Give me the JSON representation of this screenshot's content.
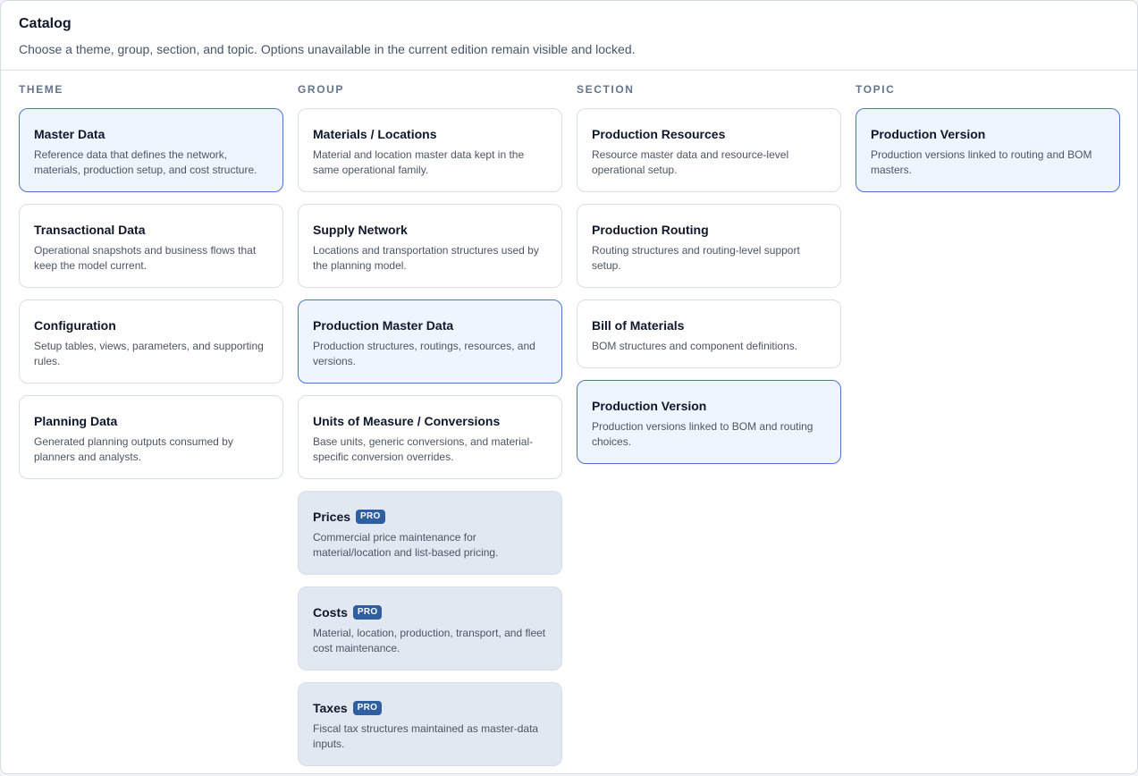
{
  "header": {
    "title": "Catalog",
    "subtitle": "Choose a theme, group, section, and topic. Options unavailable in the current edition remain visible and locked."
  },
  "columns": {
    "theme": {
      "heading": "THEME",
      "items": [
        {
          "title": "Master Data",
          "desc": "Reference data that defines the network, materials, production setup, and cost structure.",
          "state": "selected"
        },
        {
          "title": "Transactional Data",
          "desc": "Operational snapshots and business flows that keep the model current.",
          "state": "normal"
        },
        {
          "title": "Configuration",
          "desc": "Setup tables, views, parameters, and supporting rules.",
          "state": "normal"
        },
        {
          "title": "Planning Data",
          "desc": "Generated planning outputs consumed by planners and analysts.",
          "state": "normal"
        }
      ]
    },
    "group": {
      "heading": "GROUP",
      "items": [
        {
          "title": "Materials / Locations",
          "desc": "Material and location master data kept in the same operational family.",
          "state": "normal"
        },
        {
          "title": "Supply Network",
          "desc": "Locations and transportation structures used by the planning model.",
          "state": "normal"
        },
        {
          "title": "Production Master Data",
          "desc": "Production structures, routings, resources, and versions.",
          "state": "selected"
        },
        {
          "title": "Units of Measure / Conversions",
          "desc": "Base units, generic conversions, and material-specific conversion overrides.",
          "state": "normal"
        },
        {
          "title": "Prices",
          "badge": "PRO",
          "desc": "Commercial price maintenance for material/location and list-based pricing.",
          "state": "locked"
        },
        {
          "title": "Costs",
          "badge": "PRO",
          "desc": "Material, location, production, transport, and fleet cost maintenance.",
          "state": "locked"
        },
        {
          "title": "Taxes",
          "badge": "PRO",
          "desc": "Fiscal tax structures maintained as master-data inputs.",
          "state": "locked"
        }
      ]
    },
    "section": {
      "heading": "SECTION",
      "items": [
        {
          "title": "Production Resources",
          "desc": "Resource master data and resource-level operational setup.",
          "state": "normal"
        },
        {
          "title": "Production Routing",
          "desc": "Routing structures and routing-level support setup.",
          "state": "normal"
        },
        {
          "title": "Bill of Materials",
          "desc": "BOM structures and component definitions.",
          "state": "normal"
        },
        {
          "title": "Production Version",
          "desc": "Production versions linked to BOM and routing choices.",
          "state": "selected"
        }
      ]
    },
    "topic": {
      "heading": "TOPIC",
      "items": [
        {
          "title": "Production Version",
          "desc": "Production versions linked to routing and BOM masters.",
          "state": "selected"
        }
      ]
    }
  },
  "colors": {
    "selected_bg": "#eff5ff",
    "selected_border": "#4a78d0",
    "locked_bg": "#e1e8f1",
    "badge_bg": "#2f5f9e"
  }
}
